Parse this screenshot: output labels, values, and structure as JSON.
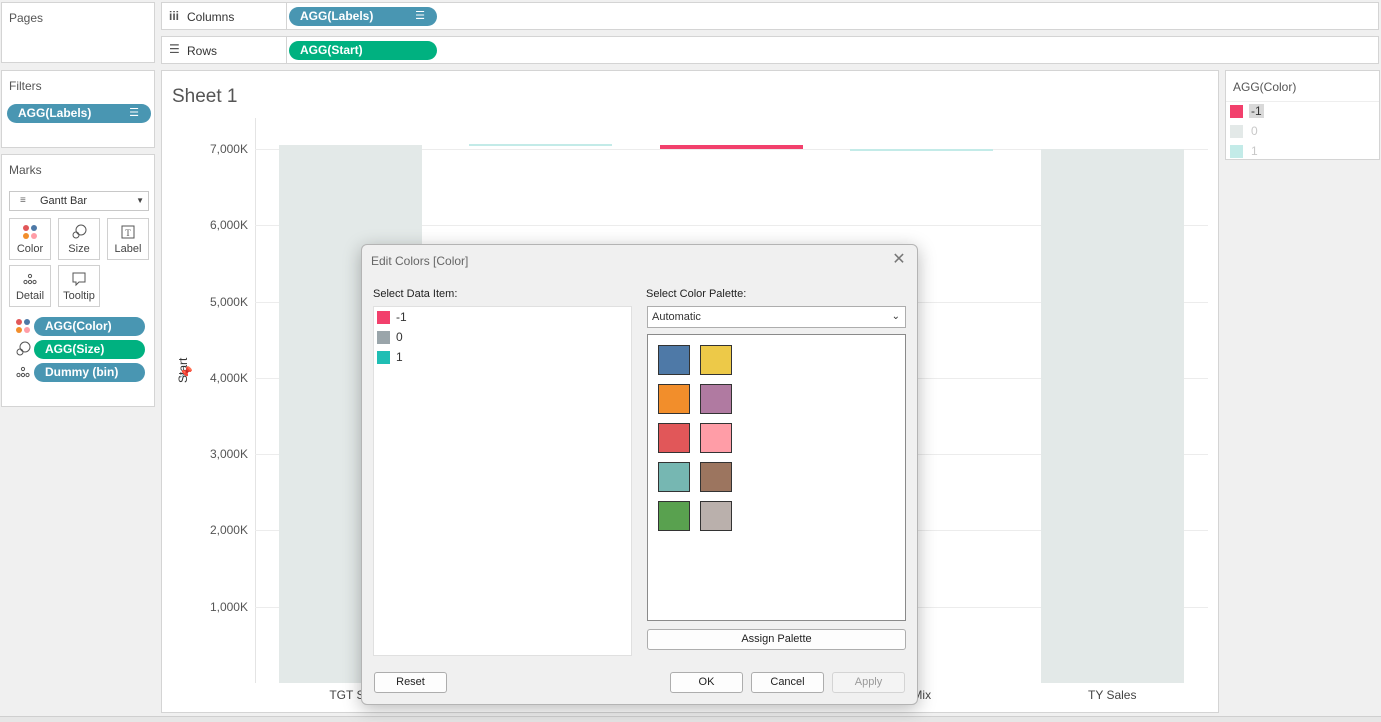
{
  "pages": {
    "title": "Pages"
  },
  "shelves": {
    "columns": {
      "label": "Columns",
      "pill": "AGG(Labels)"
    },
    "rows": {
      "label": "Rows",
      "pill": "AGG(Start)"
    }
  },
  "filters": {
    "title": "Filters",
    "pill": "AGG(Labels)"
  },
  "marks": {
    "title": "Marks",
    "mark_type": "Gantt Bar",
    "buttons": [
      "Color",
      "Size",
      "Label",
      "Detail",
      "Tooltip"
    ],
    "fields": [
      {
        "name": "AGG(Color)",
        "color": "#4996b2",
        "icon": "color-dots-icon"
      },
      {
        "name": "AGG(Size)",
        "color": "#00b180",
        "icon": "size-icon"
      },
      {
        "name": "Dummy (bin)",
        "color": "#4996b2",
        "icon": "detail-dots-icon"
      }
    ]
  },
  "sheet": {
    "title": "Sheet 1",
    "y_axis_title": "Start"
  },
  "chart_data": {
    "type": "bar",
    "categories": [
      "TGT Sa",
      "",
      "",
      "Mix",
      "TY Sales"
    ],
    "series": [
      {
        "values": [
          7050,
          7060,
          7050,
          7000,
          7000
        ],
        "bar_bottom": [
          0,
          7040,
          7000,
          6985,
          0
        ],
        "colors": [
          "#e3e9e8",
          "#c3ebe8",
          "#f2406c",
          "#c3ebe8",
          "#e3e9e8"
        ]
      }
    ],
    "yticks": [
      "1,000K",
      "2,000K",
      "3,000K",
      "4,000K",
      "5,000K",
      "6,000K",
      "7,000K"
    ],
    "ytick_values": [
      1000,
      2000,
      3000,
      4000,
      5000,
      6000,
      7000
    ],
    "ylabel": "Start",
    "ylim": [
      0,
      7500
    ],
    "grid": true
  },
  "legend": {
    "title": "AGG(Color)",
    "items": [
      {
        "label": "-1",
        "color": "#f2406c"
      },
      {
        "label": "0",
        "color": "#e3e9e8"
      },
      {
        "label": "1",
        "color": "#c3ebe8"
      }
    ]
  },
  "dialog": {
    "title": "Edit Colors [Color]",
    "select_item_label": "Select Data Item:",
    "select_palette_label": "Select Color Palette:",
    "items": [
      {
        "label": "-1",
        "color": "#f2406c"
      },
      {
        "label": "0",
        "color": "#9aa5aa"
      },
      {
        "label": "1",
        "color": "#1fbeb4"
      }
    ],
    "palette_value": "Automatic",
    "palette_colors": [
      "#4e79a7",
      "#edc948",
      "#f28e2b",
      "#b07aa1",
      "#e15759",
      "#ff9da7",
      "#76b7b2",
      "#9c755f",
      "#59a14f",
      "#bab0ac"
    ],
    "assign_palette": "Assign Palette",
    "reset": "Reset",
    "ok": "OK",
    "cancel": "Cancel",
    "apply": "Apply"
  }
}
